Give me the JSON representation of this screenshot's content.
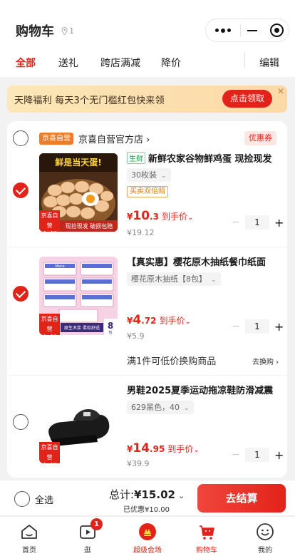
{
  "header": {
    "title": "购物车",
    "location_count": "1",
    "tabs": [
      {
        "label": "全部",
        "active": true
      },
      {
        "label": "送礼",
        "active": false
      },
      {
        "label": "跨店满减",
        "active": false
      },
      {
        "label": "降价",
        "active": false
      }
    ],
    "edit_label": "编辑"
  },
  "promo": {
    "text": "天降福利 每天3个无门槛红包快来领",
    "button": "点击领取",
    "close": "✕"
  },
  "shop": {
    "tag": "京喜自营",
    "name": "京喜自营官方店",
    "chevron": "›",
    "coupon": "优惠券",
    "checked": false
  },
  "items": [
    {
      "checked": true,
      "fresh_tag": "生鲜",
      "name": "新鲜农家谷物鲜鸡蛋 现捡现发",
      "spec": "30枚装",
      "spec_chevron": "⌄",
      "promo_tag": "买卖双倍赔",
      "price_currency": "¥",
      "price_int": "10",
      "price_dec": ".3",
      "price_tag": "到手价",
      "price_chevron": "⌄",
      "original_price": "¥19.12",
      "qty": "1",
      "image": {
        "banner": "鲜是当天蛋!",
        "footer": "现捡现发 破损包赔",
        "badge_top": "京喜自营",
        "badge_bottom": "包邮"
      }
    },
    {
      "checked": true,
      "name": "【真实惠】樱花原木抽纸餐巾纸面",
      "spec": "樱花原木抽纸【8包】",
      "spec_chevron": "⌄",
      "price_currency": "¥",
      "price_int": "4",
      "price_dec": ".72",
      "price_tag": "到手价",
      "price_chevron": "⌄",
      "original_price": "¥5.9",
      "qty": "1",
      "swap_note": "满1件可低价换购商品",
      "swap_link": "去换购 ›",
      "image": {
        "brand": "Mece",
        "footer": "原生木浆 柔软舒适",
        "count": "8",
        "count_unit": "包",
        "badge_top": "京喜自营",
        "badge_bottom": "包邮"
      }
    },
    {
      "checked": false,
      "name": "男鞋2025夏季运动拖凉鞋防滑减震",
      "spec": "629黑色，40",
      "spec_chevron": "⌄",
      "price_currency": "¥",
      "price_int": "14",
      "price_dec": ".95",
      "price_tag": "到手价",
      "price_chevron": "⌄",
      "original_price": "¥39.9",
      "qty": "1",
      "image": {
        "badge_top": "京喜自营",
        "badge_bottom": "包邮"
      }
    }
  ],
  "checkout": {
    "select_all": "全选",
    "total_label": "总计:",
    "total_value": "¥15.02",
    "total_chevron": "⌄",
    "saved": "已优惠¥10.00",
    "pay_button": "去结算"
  },
  "tabbar": [
    {
      "label": "首页",
      "icon": "home-icon",
      "active": false
    },
    {
      "label": "逛",
      "icon": "play-icon",
      "badge": "1",
      "active": false
    },
    {
      "label": "超级会场",
      "icon": "super-venue-icon",
      "active": false
    },
    {
      "label": "购物车",
      "icon": "cart-icon",
      "active": true
    },
    {
      "label": "我的",
      "icon": "profile-icon",
      "active": false
    }
  ],
  "colors": {
    "accent": "#e2231a",
    "shop_tag": "#ee7d2b",
    "promo_bg": "#fde7b8"
  }
}
